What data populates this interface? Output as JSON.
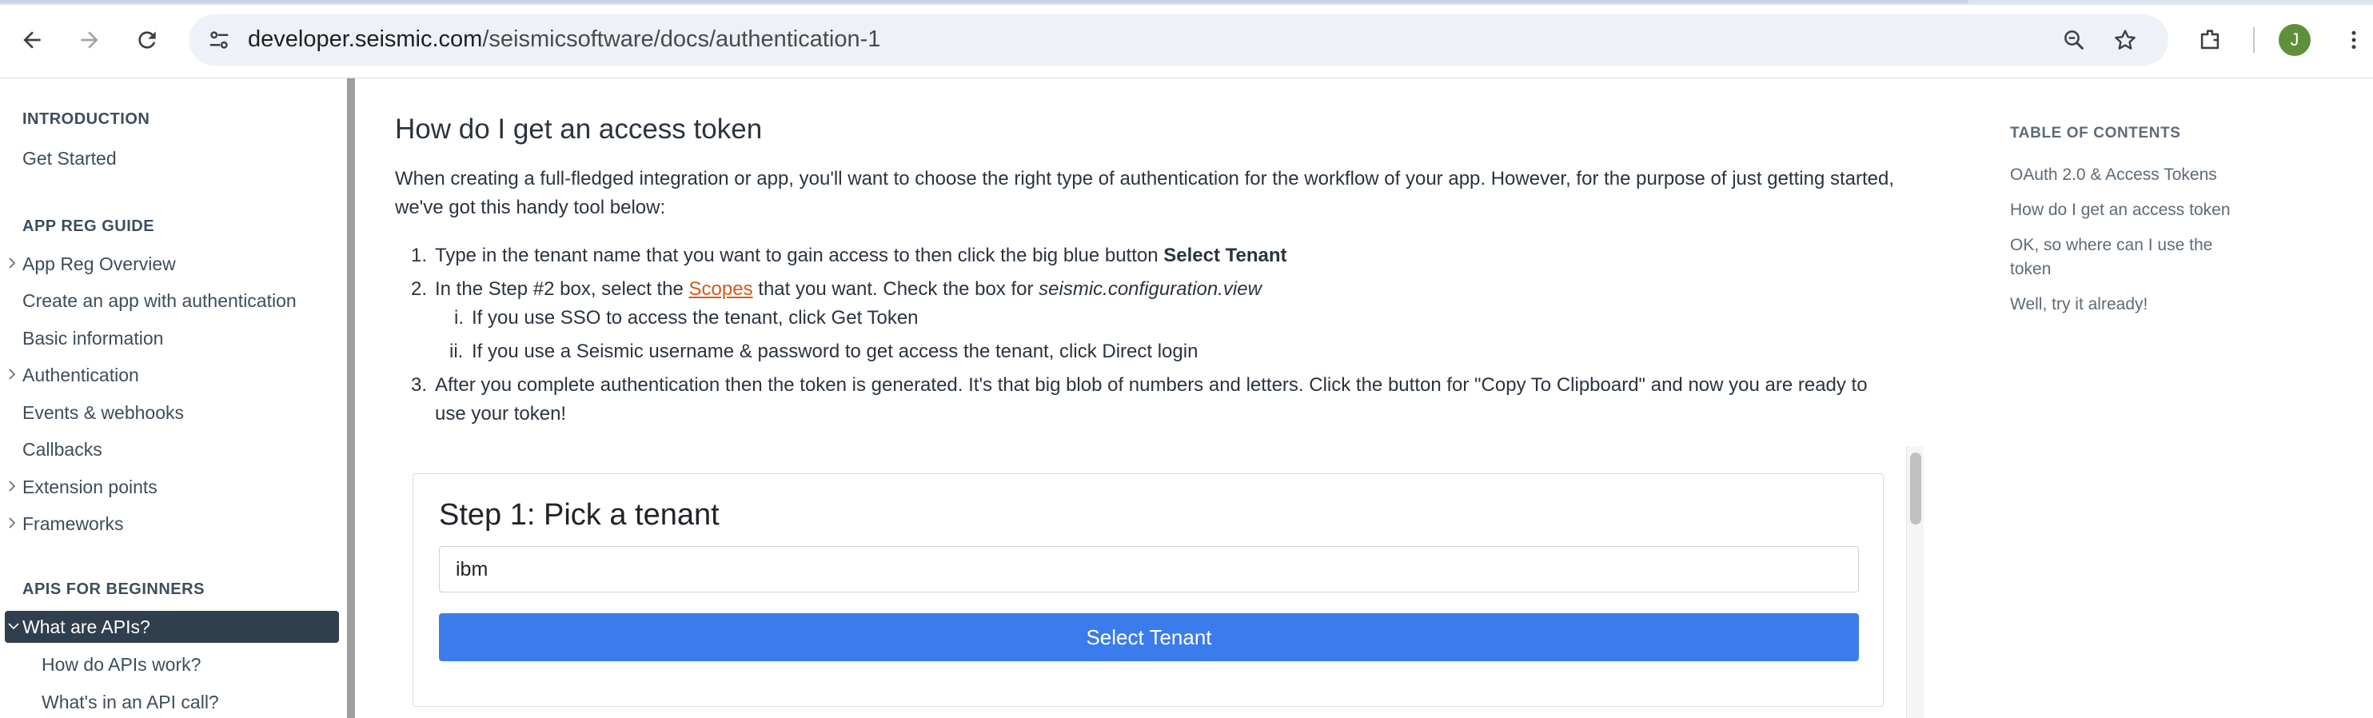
{
  "browser": {
    "url_host": "developer.seismic.com",
    "url_path": "/seismicsoftware/docs/authentication-1",
    "profile_initial": "J"
  },
  "sidebar": {
    "sections": [
      {
        "title": "INTRODUCTION",
        "items": [
          {
            "label": "Get Started",
            "expandable": false
          }
        ]
      },
      {
        "title": "APP REG GUIDE",
        "items": [
          {
            "label": "App Reg Overview",
            "expandable": true
          },
          {
            "label": "Create an app with authentication",
            "expandable": false
          },
          {
            "label": "Basic information",
            "expandable": false
          },
          {
            "label": "Authentication",
            "expandable": true
          },
          {
            "label": "Events & webhooks",
            "expandable": false
          },
          {
            "label": "Callbacks",
            "expandable": false
          },
          {
            "label": "Extension points",
            "expandable": true
          },
          {
            "label": "Frameworks",
            "expandable": true
          }
        ]
      },
      {
        "title": "APIS FOR BEGINNERS",
        "items": [
          {
            "label": "What are APIs?",
            "expandable": true,
            "active": true,
            "expanded": true
          },
          {
            "label": "How do APIs work?",
            "sub": true
          },
          {
            "label": "What's in an API call?",
            "sub": true
          }
        ]
      }
    ]
  },
  "main": {
    "heading": "How do I get an access token",
    "intro": "When creating a full-fledged integration or app, you'll want to choose the right type of authentication for the workflow of your app. However, for the purpose of just getting started, we've got this handy tool below:",
    "steps": {
      "s1_num": "1.",
      "s1_text": "Type in the tenant name that you want to gain access to then click the big blue button ",
      "s1_bold": "Select Tenant",
      "s2_num": "2.",
      "s2_pre": "In the Step #2 box, select the ",
      "s2_link": "Scopes",
      "s2_mid": " that you want. Check the box for ",
      "s2_italic": "seismic.configuration.view",
      "s2i_num": "i.",
      "s2i_text": "If you use SSO to access the tenant, click Get Token",
      "s2ii_num": "ii.",
      "s2ii_text": "If you use a Seismic username & password to get access the tenant, click Direct login",
      "s3_num": "3.",
      "s3_line1": "After you complete authentication then the token is generated. It's that big blob of numbers and letters. Click the button for \"Copy To Clipboard\" and now you are ready to",
      "s3_line2": "use your token!"
    },
    "tool": {
      "title": "Step 1: Pick a tenant",
      "tenant_value": "ibm",
      "button_label": "Select Tenant",
      "button_color": "#3b7ced"
    }
  },
  "toc": {
    "title": "TABLE OF CONTENTS",
    "items": [
      "OAuth 2.0 & Access Tokens",
      "How do I get an access token",
      "OK, so where can I use the token",
      "Well, try it already!"
    ]
  },
  "colors": {
    "active_nav_bg": "#2f3f4d",
    "link": "#d4591f",
    "text": "#2a3440"
  },
  "icons": [
    "back-arrow-icon",
    "forward-arrow-icon",
    "reload-icon",
    "site-info-icon",
    "zoom-icon",
    "star-icon",
    "extensions-icon",
    "more-vert-icon",
    "chevron-right-icon",
    "chevron-down-icon"
  ]
}
